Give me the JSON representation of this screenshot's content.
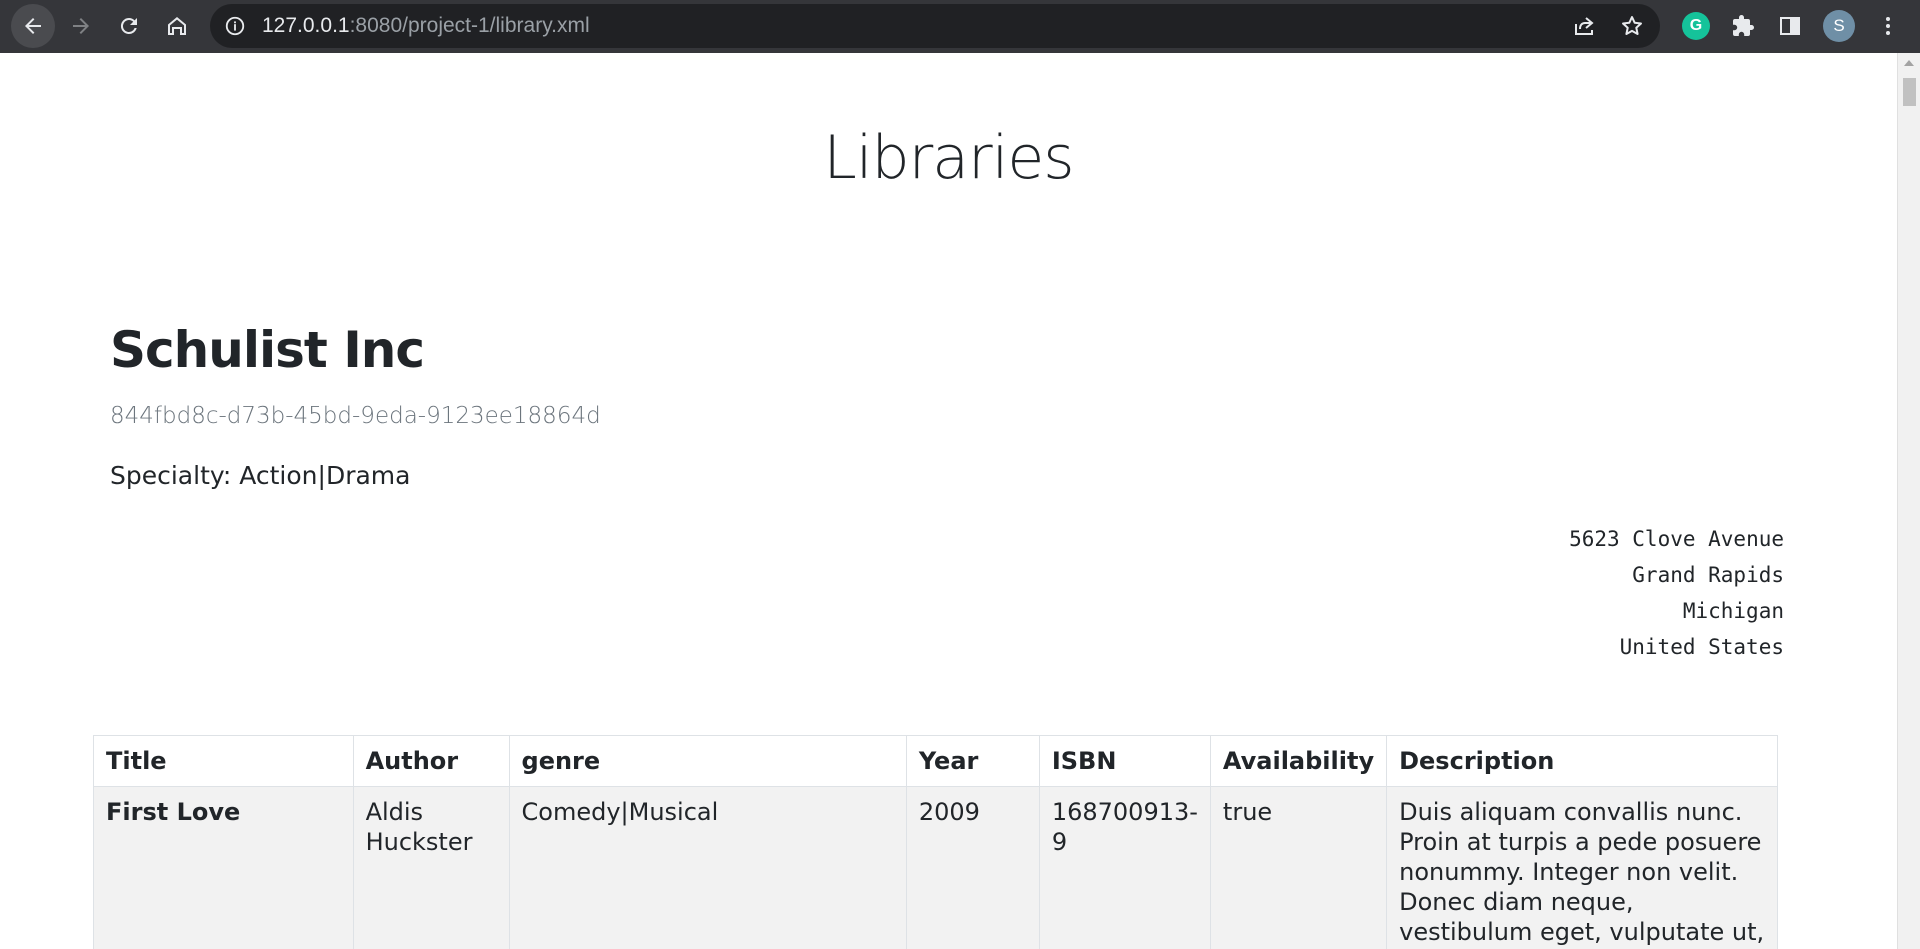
{
  "browser": {
    "url_host": "127.0.0.1",
    "url_rest": ":8080/project-1/library.xml",
    "profile_initial": "S",
    "grammarly_letter": "G"
  },
  "page": {
    "title": "Libraries",
    "library": {
      "name": "Schulist Inc",
      "id": "844fbd8c-d73b-45bd-9eda-9123ee18864d",
      "specialty": "Specialty: Action|Drama",
      "address": [
        "5623 Clove Avenue",
        "Grand Rapids",
        "Michigan",
        "United States"
      ]
    },
    "table": {
      "headers": [
        "Title",
        "Author",
        "genre",
        "Year",
        "ISBN",
        "Availability",
        "Description"
      ],
      "rows": [
        {
          "title": "First Love",
          "author": "Aldis Huckster",
          "genre": "Comedy|Musical",
          "year": "2009",
          "isbn": "168700913-9",
          "availability": "true",
          "description": "Duis aliquam convallis nunc. Proin at turpis a pede posuere nonummy. Integer non velit. Donec diam neque, vestibulum eget, vulputate ut, ultrices vel,"
        }
      ]
    }
  },
  "colors": {
    "chrome": "#35363a",
    "omnibox": "#202124",
    "text": "#212529",
    "muted": "#6c757d",
    "row_bg": "#f2f2f2"
  }
}
